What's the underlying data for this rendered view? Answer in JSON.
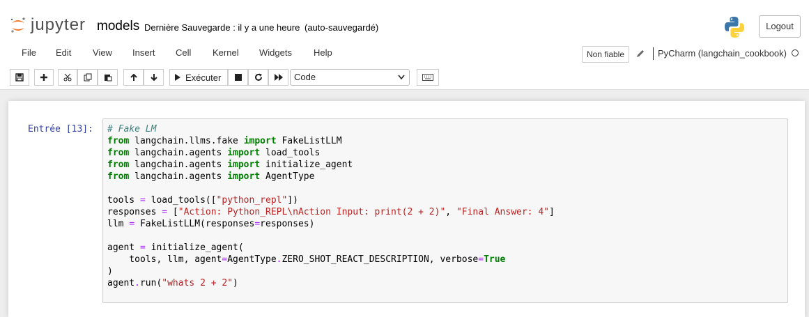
{
  "header": {
    "logo_text": "jupyter",
    "notebook_name": "models",
    "checkpoint": "Dernière Sauvegarde : il y a une heure",
    "autosave": "(auto-sauvegardé)",
    "logout_label": "Logout"
  },
  "menubar": {
    "items": [
      "File",
      "Edit",
      "View",
      "Insert",
      "Cell",
      "Kernel",
      "Widgets",
      "Help"
    ],
    "trust_label": "Non fiable",
    "kernel_name": "PyCharm (langchain_cookbook)"
  },
  "toolbar": {
    "run_label": "Exécuter",
    "cell_type": "Code",
    "cell_type_options": [
      "Code"
    ]
  },
  "cell": {
    "prompt": "Entrée [13]:",
    "code_lines": [
      "# Fake LM",
      "from langchain.llms.fake import FakeListLLM",
      "from langchain.agents import load_tools",
      "from langchain.agents import initialize_agent",
      "from langchain.agents import AgentType",
      "",
      "tools = load_tools([\"python_repl\"])",
      "responses = [\"Action: Python_REPL\\nAction Input: print(2 + 2)\", \"Final Answer: 4\"]",
      "llm = FakeListLLM(responses=responses)",
      "",
      "agent = initialize_agent(",
      "    tools, llm, agent=AgentType.ZERO_SHOT_REACT_DESCRIPTION, verbose=True",
      ")",
      "agent.run(\"whats 2 + 2\")"
    ]
  },
  "colors": {
    "keyword": "#008000",
    "string": "#ba2121",
    "comment": "#408080",
    "prompt": "#303f9f",
    "logo_orange": "#f37726"
  },
  "icons": {
    "toolbar": [
      "save-icon",
      "plus-icon",
      "cut-icon",
      "copy-icon",
      "paste-icon",
      "arrow-up-icon",
      "arrow-down-icon",
      "play-icon",
      "stop-icon",
      "restart-icon",
      "fast-forward-icon",
      "keyboard-icon"
    ]
  }
}
